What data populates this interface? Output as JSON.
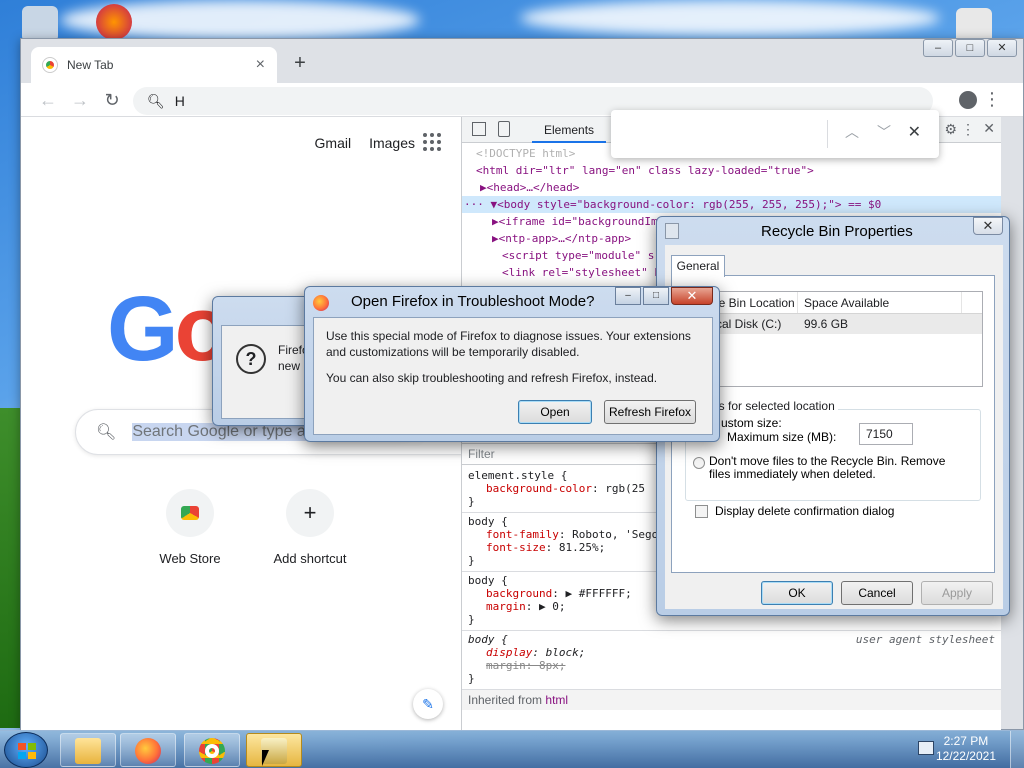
{
  "browser": {
    "tab_title": "New Tab",
    "address_value": "H"
  },
  "page": {
    "links": [
      "Gmail",
      "Images"
    ],
    "logo_letters": [
      "G",
      "o"
    ],
    "search_placeholder": "Search Google or type a",
    "shortcuts": [
      {
        "label": "Web Store"
      },
      {
        "label": "Add shortcut",
        "glyph": "+"
      }
    ]
  },
  "devtools": {
    "tab": "Elements",
    "dom": [
      "<!DOCTYPE html>",
      "<html dir=\"ltr\" lang=\"en\" class lazy-loaded=\"true\">",
      "▶<head>…</head>",
      "··· ▼<body style=\"background-color: rgb(255, 255, 255);\"> == $0",
      "▶<iframe id=\"backgroundIm",
      "▶<ntp-app>…</ntp-app>",
      "<script type=\"module\" sr",
      "<link rel=\"stylesheet\" h"
    ],
    "filter_placeholder": "Filter",
    "rules": [
      {
        "selector": "element.style {",
        "props": [
          {
            "name": "background-color",
            "value": "rgb(25"
          }
        ]
      },
      {
        "selector": "body {",
        "props": [
          {
            "name": "font-family",
            "value": "Roboto, 'Sego"
          },
          {
            "name": "font-size",
            "value": "81.25%;"
          }
        ]
      },
      {
        "selector": "body {",
        "props": [
          {
            "name": "background",
            "value": "▶ #FFFFFF;"
          },
          {
            "name": "margin",
            "value": "▶ 0;"
          }
        ]
      },
      {
        "selector": "body {",
        "origin": "user agent stylesheet",
        "props": [
          {
            "name": "display",
            "value": "block;"
          },
          {
            "name": "margin",
            "value": "8px;"
          }
        ]
      }
    ],
    "inherited_label": "Inherited from",
    "inherited_tag": "html"
  },
  "firefox_dialog": {
    "title": "Open Firefox in Troubleshoot Mode?",
    "text1": "Use this special mode of Firefox to diagnose issues. Your extensions and customizations will be temporarily disabled.",
    "text2": "You can also skip troubleshooting and refresh Firefox, instead.",
    "open_button": "Open",
    "refresh_button": "Refresh Firefox"
  },
  "behind_dialog": {
    "text": "Firefo new"
  },
  "recycle_bin": {
    "title": "Recycle Bin Properties",
    "tab": "General",
    "columns": [
      "le Bin Location",
      "Space Available"
    ],
    "rows": [
      [
        "cal Disk (C:)",
        "99.6 GB"
      ]
    ],
    "group_title": "gs for selected location",
    "custom_size": "ustom size:",
    "max_size_label": "Maximum size (MB):",
    "max_size_value": "7150",
    "dont_move_label": "Don't move files to the Recycle Bin. Remove files immediately when deleted.",
    "display_confirm_label": "Display delete confirmation dialog",
    "ok": "OK",
    "cancel": "Cancel",
    "apply": "Apply"
  },
  "taskbar": {
    "time": "2:27 PM",
    "date": "12/22/2021"
  }
}
